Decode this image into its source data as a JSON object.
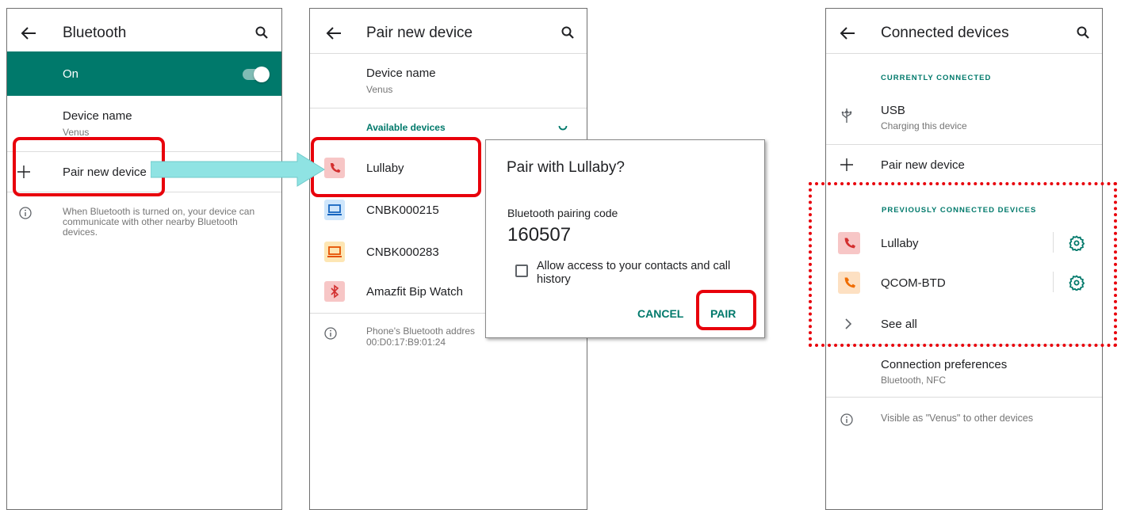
{
  "screen1": {
    "title": "Bluetooth",
    "toggle_label": "On",
    "device_name_title": "Device name",
    "device_name_value": "Venus",
    "pair_new_device": "Pair new device",
    "info_text": "When Bluetooth is turned on, your device can communicate with other nearby Bluetooth devices."
  },
  "screen2": {
    "title": "Pair new device",
    "device_name_title": "Device name",
    "device_name_value": "Venus",
    "available_header": "Available devices",
    "devices": [
      {
        "label": "Lullaby",
        "icon": "phone-icon",
        "color": "#f7c6c6"
      },
      {
        "label": "CNBK000215",
        "icon": "laptop-icon",
        "color": "#cfe6fb"
      },
      {
        "label": "CNBK000283",
        "icon": "laptop-icon",
        "color": "#fde6b4"
      },
      {
        "label": "Amazfit Bip Watch",
        "icon": "bluetooth-icon",
        "color": "#f7c6c6"
      }
    ],
    "info_line1": "Phone's Bluetooth addres",
    "info_line2": "00:D0:17:B9:01:24"
  },
  "dialog": {
    "title": "Pair with Lullaby?",
    "code_label": "Bluetooth pairing code",
    "code": "160507",
    "checkbox_line1": "Allow access to your contacts and call",
    "checkbox_line2": "history",
    "cancel": "CANCEL",
    "pair": "PAIR"
  },
  "screen3": {
    "title": "Connected devices",
    "currently_header": "CURRENTLY CONNECTED",
    "usb_title": "USB",
    "usb_sub": "Charging this device",
    "pair_new_device": "Pair new device",
    "previously_header": "PREVIOUSLY CONNECTED DEVICES",
    "prev_devices": [
      {
        "label": "Lullaby",
        "icon": "phone-icon",
        "color": "#f7c6c6"
      },
      {
        "label": "QCOM-BTD",
        "icon": "phone-icon",
        "color": "#fde0c2"
      }
    ],
    "see_all": "See all",
    "conn_pref_title": "Connection preferences",
    "conn_pref_sub": "Bluetooth, NFC",
    "visible_text": "Visible as \"Venus\" to other devices"
  },
  "colors": {
    "accent": "#00796b",
    "highlight": "#e8000b",
    "arrow": "#8fe3e3"
  }
}
